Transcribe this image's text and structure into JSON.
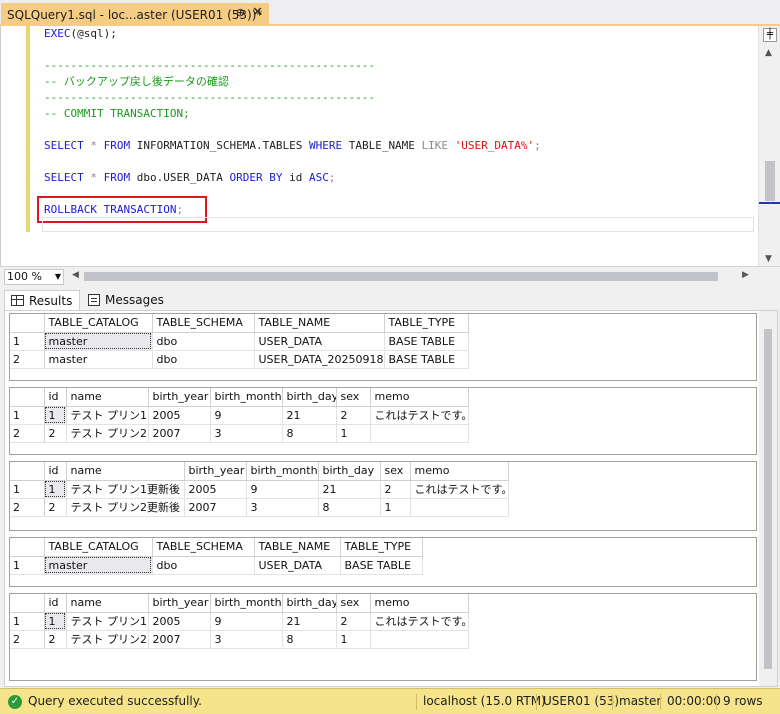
{
  "tab": {
    "title": "SQLQuery1.sql - loc...aster (USER01 (53))*",
    "pin": "⊕",
    "close": "✕"
  },
  "editor": {
    "line1": [
      "EXEC",
      "(@sql);"
    ],
    "sep": "--------------------------------------------------",
    "comment1": "-- バックアップ戻し後データの確認",
    "comment2": "-- COMMIT TRANSACTION;",
    "q1": {
      "select": "SELECT",
      "star": "*",
      "from": "FROM",
      "obj": "INFORMATION_SCHEMA.TABLES",
      "where": "WHERE",
      "col": "TABLE_NAME",
      "like": "LIKE",
      "str": "'USER_DATA%'",
      "end": ";"
    },
    "q2": {
      "select": "SELECT",
      "star": "*",
      "from": "FROM",
      "obj": "dbo.USER_DATA",
      "order": "ORDER BY",
      "col": "id",
      "asc": "ASC",
      "end": ";"
    },
    "rollback": {
      "kw": "ROLLBACK TRANSACTION",
      "end": ";"
    }
  },
  "zoom": "100 %",
  "result_tabs": {
    "results": "Results",
    "messages": "Messages"
  },
  "grids": [
    {
      "headers": [
        "TABLE_CATALOG",
        "TABLE_SCHEMA",
        "TABLE_NAME",
        "TABLE_TYPE"
      ],
      "rows": [
        [
          "1",
          "master",
          "dbo",
          "USER_DATA",
          "BASE TABLE"
        ],
        [
          "2",
          "master",
          "dbo",
          "USER_DATA_20250918",
          "BASE TABLE"
        ]
      ]
    },
    {
      "headers": [
        "id",
        "name",
        "birth_year",
        "birth_month",
        "birth_day",
        "sex",
        "memo"
      ],
      "rows": [
        [
          "1",
          "1",
          "テスト プリン1",
          "2005",
          "9",
          "21",
          "2",
          "これはテストです。"
        ],
        [
          "2",
          "2",
          "テスト プリン2",
          "2007",
          "3",
          "8",
          "1",
          ""
        ]
      ]
    },
    {
      "headers": [
        "id",
        "name",
        "birth_year",
        "birth_month",
        "birth_day",
        "sex",
        "memo"
      ],
      "rows": [
        [
          "1",
          "1",
          "テスト プリン1更新後",
          "2005",
          "9",
          "21",
          "2",
          "これはテストです。"
        ],
        [
          "2",
          "2",
          "テスト プリン2更新後",
          "2007",
          "3",
          "8",
          "1",
          ""
        ]
      ]
    },
    {
      "headers": [
        "TABLE_CATALOG",
        "TABLE_SCHEMA",
        "TABLE_NAME",
        "TABLE_TYPE"
      ],
      "rows": [
        [
          "1",
          "master",
          "dbo",
          "USER_DATA",
          "BASE TABLE"
        ]
      ]
    },
    {
      "headers": [
        "id",
        "name",
        "birth_year",
        "birth_month",
        "birth_day",
        "sex",
        "memo"
      ],
      "rows": [
        [
          "1",
          "1",
          "テスト プリン1",
          "2005",
          "9",
          "21",
          "2",
          "これはテストです。"
        ],
        [
          "2",
          "2",
          "テスト プリン2",
          "2007",
          "3",
          "8",
          "1",
          ""
        ]
      ]
    }
  ],
  "status": {
    "message": "Query executed successfully.",
    "server": "localhost (15.0 RTM)",
    "user": "USER01 (53)",
    "database": "master",
    "elapsed": "00:00:00",
    "rows": "9 rows"
  },
  "colors": {
    "accent": "#f5cc84",
    "status_bar": "#f5e48a",
    "keyword": "#1b1bd2",
    "comment": "#199a19",
    "string": "#d31313",
    "highlight_box": "#e0141e"
  }
}
